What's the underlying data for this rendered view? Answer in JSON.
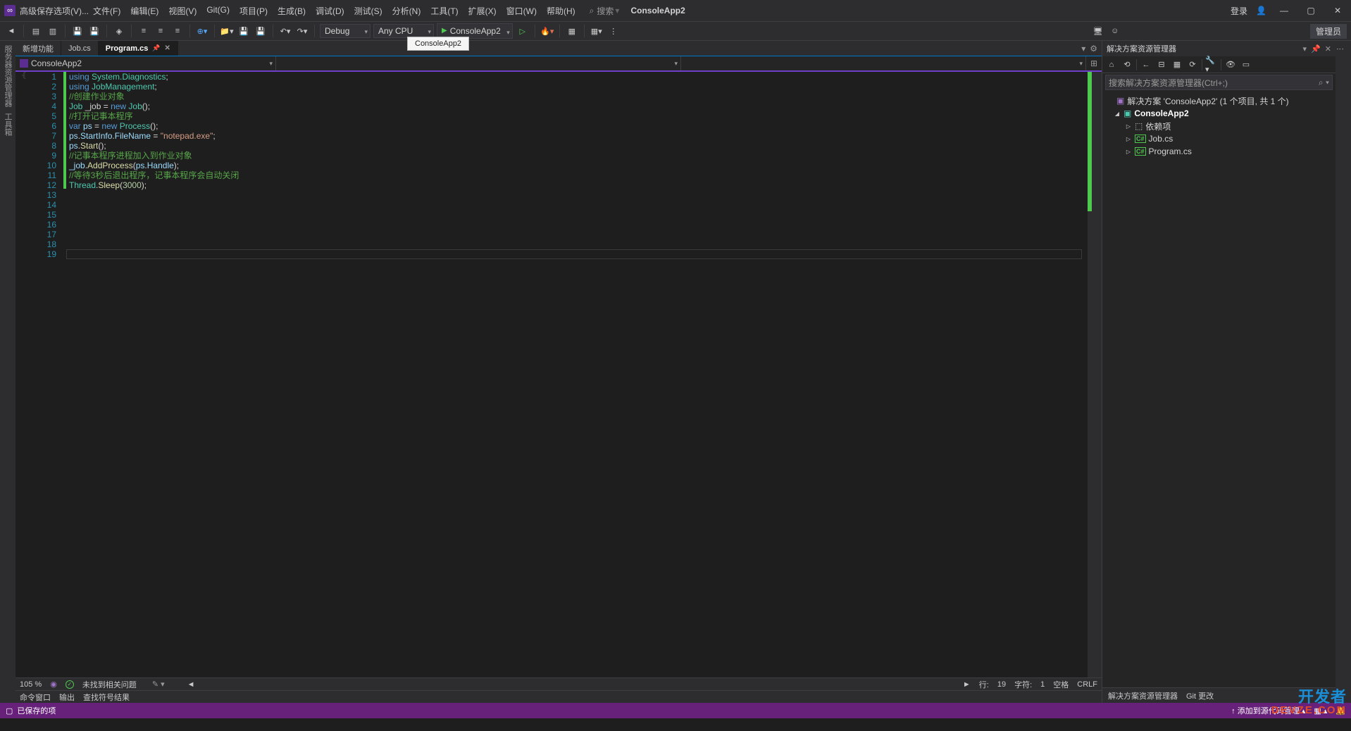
{
  "menu": {
    "advanced_save": "高级保存选项(V)...",
    "items": [
      "文件(F)",
      "编辑(E)",
      "视图(V)",
      "Git(G)",
      "项目(P)",
      "生成(B)",
      "调试(D)",
      "测试(S)",
      "分析(N)",
      "工具(T)",
      "扩展(X)",
      "窗口(W)",
      "帮助(H)"
    ],
    "search_label": "搜索",
    "app_title": "ConsoleApp2",
    "login": "登录"
  },
  "toolbar": {
    "config": "Debug",
    "platform": "Any CPU",
    "run_target": "ConsoleApp2",
    "tooltip": "ConsoleApp2",
    "admin": "管理员"
  },
  "tabs": {
    "items": [
      {
        "label": "新增功能",
        "active": false
      },
      {
        "label": "Job.cs",
        "active": false
      },
      {
        "label": "Program.cs",
        "active": true
      }
    ]
  },
  "nav": {
    "project": "ConsoleApp2",
    "scope": "",
    "member": ""
  },
  "code": {
    "lines": [
      {
        "n": 1,
        "seg": [
          {
            "t": "using ",
            "c": "kw"
          },
          {
            "t": "System.Diagnostics",
            "c": "cls"
          },
          {
            "t": ";",
            "c": "plain"
          }
        ]
      },
      {
        "n": 2,
        "seg": [
          {
            "t": "using ",
            "c": "kw"
          },
          {
            "t": "JobManagement",
            "c": "cls"
          },
          {
            "t": ";",
            "c": "plain"
          }
        ]
      },
      {
        "n": 3,
        "seg": [
          {
            "t": "//创建作业对象",
            "c": "com"
          }
        ]
      },
      {
        "n": 4,
        "seg": [
          {
            "t": "Job",
            "c": "cls"
          },
          {
            "t": " _job = ",
            "c": "plain"
          },
          {
            "t": "new ",
            "c": "kw"
          },
          {
            "t": "Job",
            "c": "cls"
          },
          {
            "t": "();",
            "c": "plain"
          }
        ]
      },
      {
        "n": 5,
        "seg": [
          {
            "t": "//打开记事本程序",
            "c": "com"
          }
        ]
      },
      {
        "n": 6,
        "seg": [
          {
            "t": "var ",
            "c": "kw"
          },
          {
            "t": "ps",
            "c": "var"
          },
          {
            "t": " = ",
            "c": "plain"
          },
          {
            "t": "new ",
            "c": "kw"
          },
          {
            "t": "Process",
            "c": "cls"
          },
          {
            "t": "();",
            "c": "plain"
          }
        ]
      },
      {
        "n": 7,
        "seg": [
          {
            "t": "ps",
            "c": "var"
          },
          {
            "t": ".",
            "c": "plain"
          },
          {
            "t": "StartInfo",
            "c": "var"
          },
          {
            "t": ".",
            "c": "plain"
          },
          {
            "t": "FileName",
            "c": "var"
          },
          {
            "t": " = ",
            "c": "plain"
          },
          {
            "t": "\"notepad.exe\"",
            "c": "str"
          },
          {
            "t": ";",
            "c": "plain"
          }
        ]
      },
      {
        "n": 8,
        "seg": [
          {
            "t": "ps",
            "c": "var"
          },
          {
            "t": ".",
            "c": "plain"
          },
          {
            "t": "Start",
            "c": "fn"
          },
          {
            "t": "();",
            "c": "plain"
          }
        ]
      },
      {
        "n": 9,
        "seg": [
          {
            "t": "//记事本程序进程加入到作业对象",
            "c": "com"
          }
        ]
      },
      {
        "n": 10,
        "seg": [
          {
            "t": "_job",
            "c": "var"
          },
          {
            "t": ".",
            "c": "plain"
          },
          {
            "t": "AddProcess",
            "c": "fn"
          },
          {
            "t": "(",
            "c": "plain"
          },
          {
            "t": "ps",
            "c": "var"
          },
          {
            "t": ".",
            "c": "plain"
          },
          {
            "t": "Handle",
            "c": "var"
          },
          {
            "t": ");",
            "c": "plain"
          }
        ]
      },
      {
        "n": 11,
        "seg": [
          {
            "t": "//等待3秒后退出程序，记事本程序会自动关闭",
            "c": "com"
          }
        ]
      },
      {
        "n": 12,
        "seg": [
          {
            "t": "Thread",
            "c": "cls"
          },
          {
            "t": ".",
            "c": "plain"
          },
          {
            "t": "Sleep",
            "c": "fn"
          },
          {
            "t": "(",
            "c": "plain"
          },
          {
            "t": "3000",
            "c": "num"
          },
          {
            "t": ");",
            "c": "plain"
          }
        ]
      },
      {
        "n": 13,
        "seg": []
      },
      {
        "n": 14,
        "seg": []
      },
      {
        "n": 15,
        "seg": []
      },
      {
        "n": 16,
        "seg": []
      },
      {
        "n": 17,
        "seg": []
      },
      {
        "n": 18,
        "seg": []
      },
      {
        "n": 19,
        "seg": []
      }
    ],
    "cursor_line": 19
  },
  "solution_explorer": {
    "title": "解决方案资源管理器",
    "search_placeholder": "搜索解决方案资源管理器(Ctrl+;)",
    "root": "解决方案 'ConsoleApp2' (1 个项目, 共 1 个)",
    "project": "ConsoleApp2",
    "nodes": [
      {
        "label": "依赖项",
        "icon": "dep"
      },
      {
        "label": "Job.cs",
        "icon": "cs"
      },
      {
        "label": "Program.cs",
        "icon": "cs"
      }
    ]
  },
  "editor_status": {
    "zoom": "105 %",
    "issues": "未找到相关问题",
    "ln_label": "行:",
    "ln": "19",
    "ch_label": "字符:",
    "ch": "1",
    "ins": "空格",
    "eol": "CRLF"
  },
  "output_tabs": [
    "命令窗口",
    "输出",
    "查找符号结果"
  ],
  "panel_footer": {
    "solution_explorer": "解决方案资源管理器",
    "git_changes": "Git 更改"
  },
  "bottom": {
    "saved": "已保存的项",
    "add_source": "添加到源代码管理"
  },
  "watermark": {
    "l1": "开发者",
    "l2": "DEVZE.COM"
  }
}
